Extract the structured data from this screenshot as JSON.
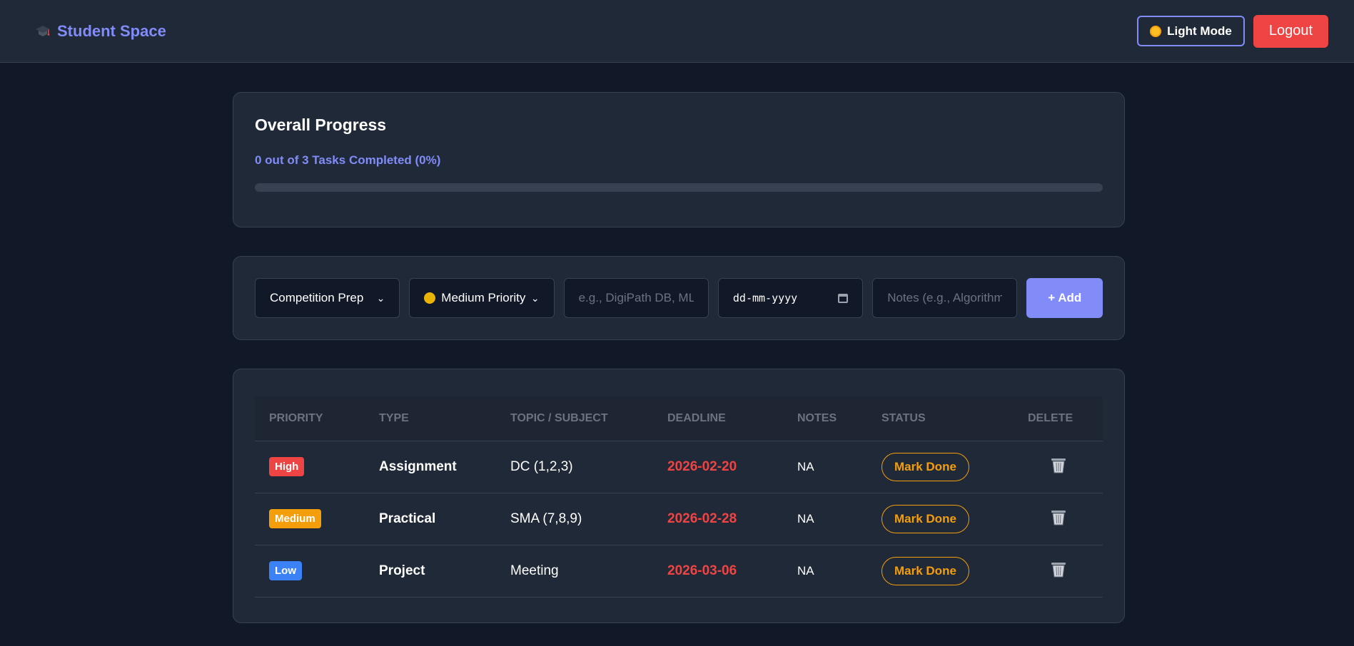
{
  "header": {
    "title": "Student Space",
    "light_mode_label": "Light Mode",
    "logout_label": "Logout"
  },
  "progress": {
    "title": "Overall Progress",
    "summary": "0 out of 3 Tasks Completed (0%)",
    "percent": 0
  },
  "form": {
    "type_value": "Competition Prep",
    "priority_value": "Medium Priority",
    "topic_placeholder": "e.g., DigiPath DB, ML N",
    "date_placeholder": "dd-mm-yyyy",
    "notes_placeholder": "Notes (e.g., Algorithm r",
    "add_label": "+ Add"
  },
  "table": {
    "headers": [
      "PRIORITY",
      "TYPE",
      "TOPIC / SUBJECT",
      "DEADLINE",
      "NOTES",
      "STATUS",
      "DELETE"
    ],
    "rows": [
      {
        "priority": "High",
        "type": "Assignment",
        "topic": "DC (1,2,3)",
        "deadline": "2026-02-20",
        "notes": "NA",
        "status": "Mark Done"
      },
      {
        "priority": "Medium",
        "type": "Practical",
        "topic": "SMA (7,8,9)",
        "deadline": "2026-02-28",
        "notes": "NA",
        "status": "Mark Done"
      },
      {
        "priority": "Low",
        "type": "Project",
        "topic": "Meeting",
        "deadline": "2026-03-06",
        "notes": "NA",
        "status": "Mark Done"
      }
    ]
  },
  "colors": {
    "accent": "#818cf8",
    "danger": "#ef4444",
    "warning": "#f59e0b",
    "info": "#3b82f6",
    "background": "#111827",
    "card": "#1f2937"
  }
}
